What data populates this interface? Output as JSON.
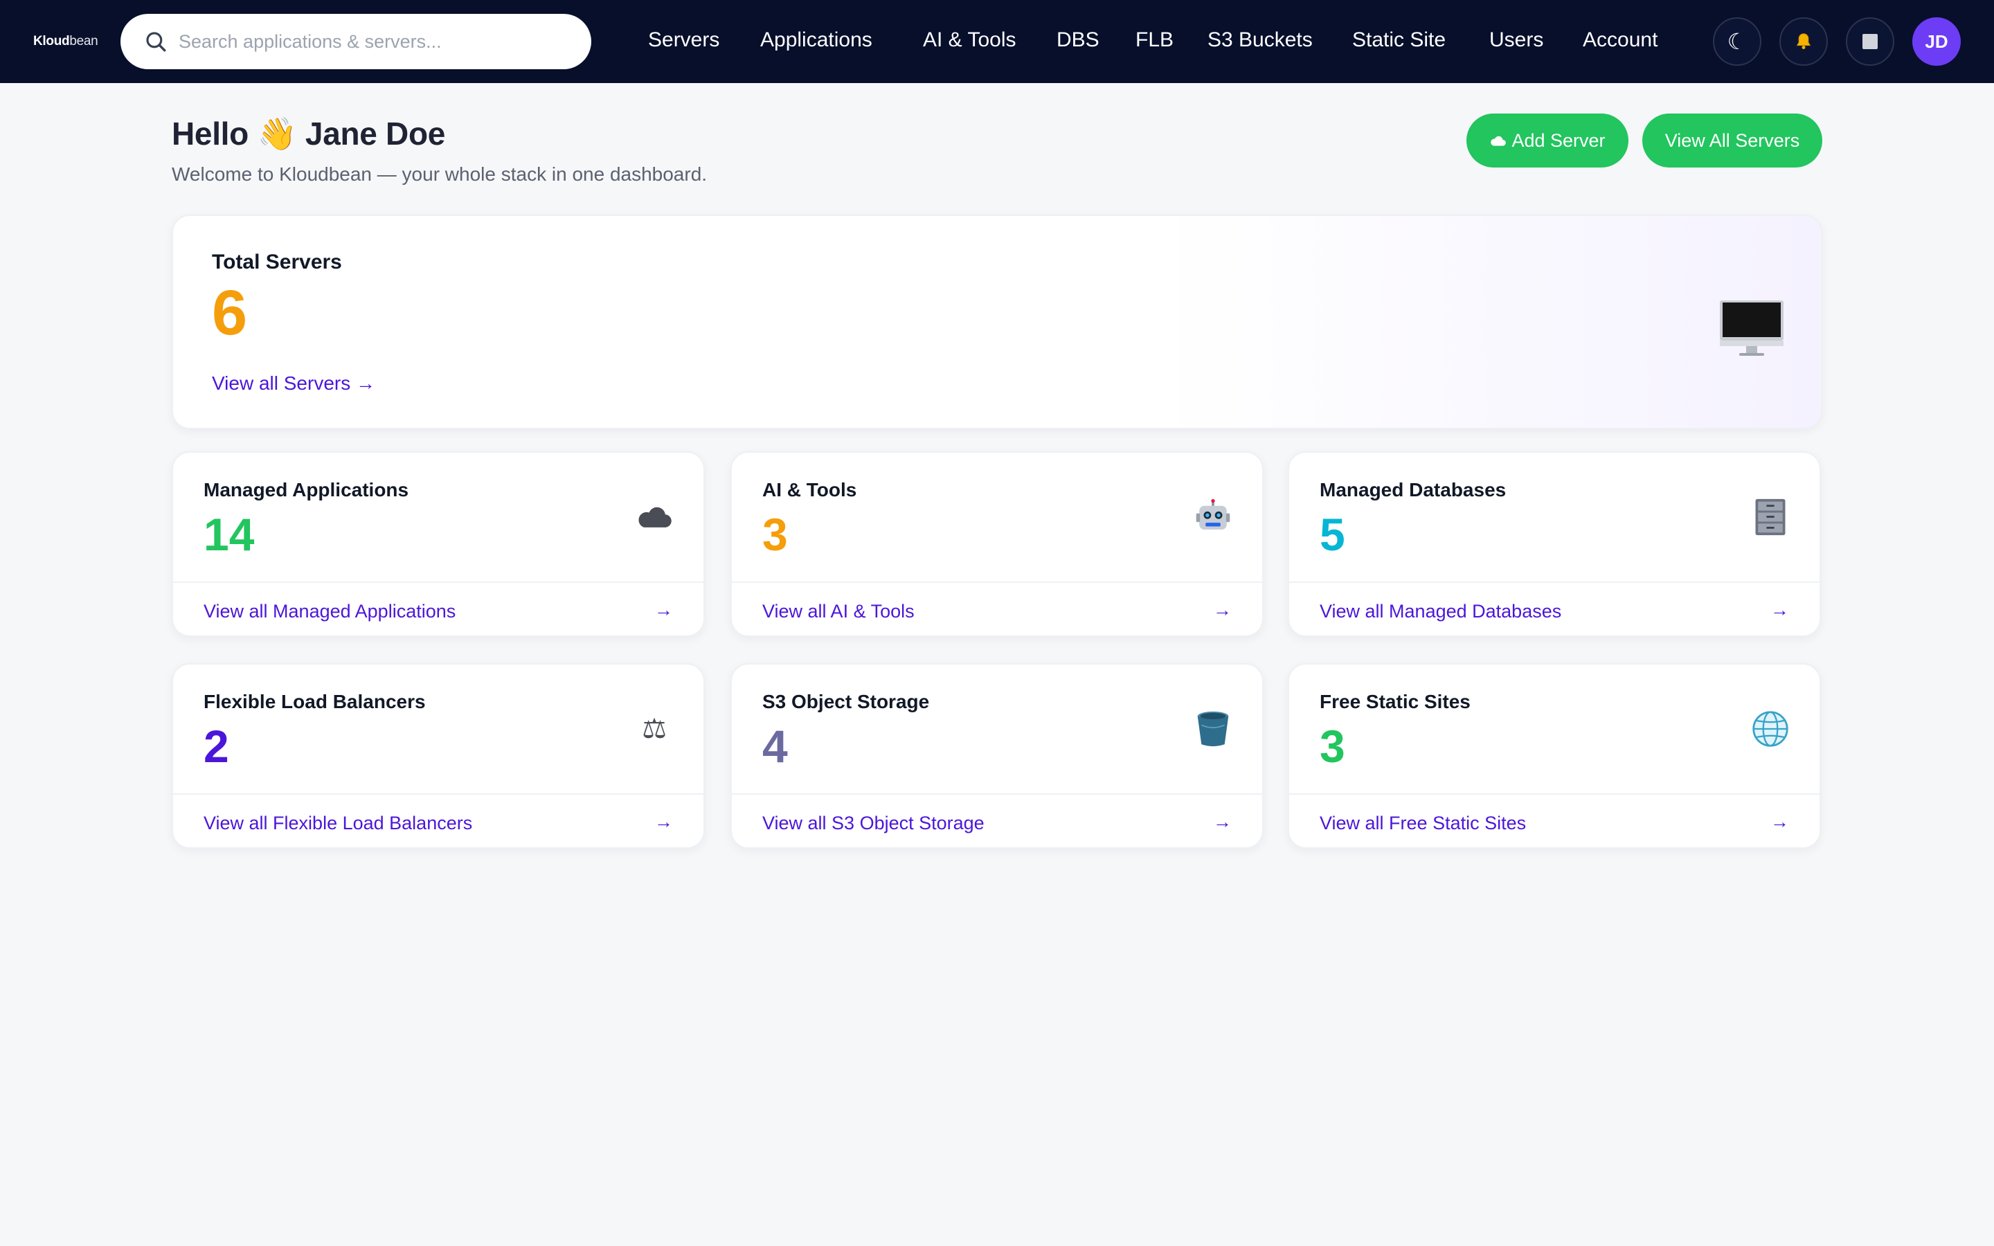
{
  "topbar": {
    "logo": {
      "bold": "Kloud",
      "light": "bean"
    },
    "search": {
      "placeholder": "Search applications & servers..."
    },
    "nav": [
      "Servers",
      "Applications",
      "AI & Tools",
      "DBS",
      "FLB",
      "S3 Buckets",
      "Static Site",
      "Users",
      "Account"
    ],
    "icons": {
      "theme": "moon-icon",
      "notifications": "bell-icon",
      "apps": "grid-icon"
    },
    "avatar_initials": "JD"
  },
  "header": {
    "greeting_prefix": "Hello",
    "greeting_emoji": "👋",
    "user_name": "Jane Doe",
    "subtitle": "Welcome to Kloudbean — your whole stack in one dashboard.",
    "add_server_label": "Add Server",
    "view_all_servers_label": "View All Servers"
  },
  "summary": {
    "label": "Total Servers",
    "value": "6",
    "link": "View all Servers →",
    "icon": "monitor-icon"
  },
  "cards": [
    {
      "label": "Managed Applications",
      "value": "14",
      "link": "View all Managed Applications",
      "arrow": "→",
      "icon": "cloud-icon",
      "color": "#22c55e"
    },
    {
      "label": "AI & Tools",
      "value": "3",
      "link": "View all AI & Tools",
      "arrow": "→",
      "icon": "robot-icon",
      "color": "#f59e0b"
    },
    {
      "label": "Managed Databases",
      "value": "5",
      "link": "View all Managed Databases",
      "arrow": "→",
      "icon": "file-cabinet-icon",
      "color": "#06b6d4"
    },
    {
      "label": "Flexible Load Balancers",
      "value": "2",
      "link": "View all Flexible Load Balancers",
      "arrow": "→",
      "icon": "scales-icon",
      "color": "#4b16d9"
    },
    {
      "label": "S3 Object Storage",
      "value": "4",
      "link": "View all S3 Object Storage",
      "arrow": "→",
      "icon": "bucket-icon",
      "color": "#6b6aa0"
    },
    {
      "label": "Free Static Sites",
      "value": "3",
      "link": "View all Free Static Sites",
      "arrow": "→",
      "icon": "globe-icon",
      "color": "#22c55e"
    }
  ]
}
